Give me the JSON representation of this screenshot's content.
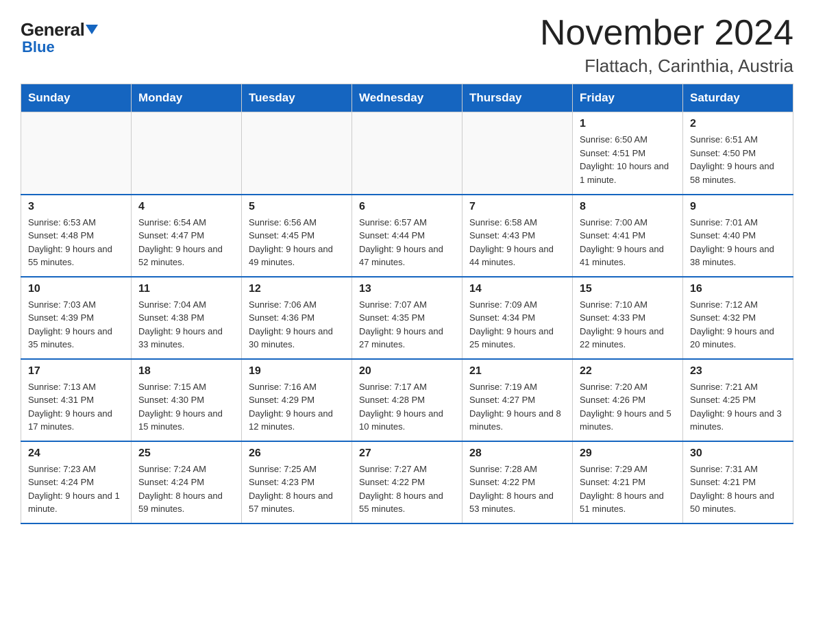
{
  "logo": {
    "general": "General",
    "blue": "Blue",
    "triangle_color": "#1565c0"
  },
  "title": "November 2024",
  "subtitle": "Flattach, Carinthia, Austria",
  "days_of_week": [
    "Sunday",
    "Monday",
    "Tuesday",
    "Wednesday",
    "Thursday",
    "Friday",
    "Saturday"
  ],
  "weeks": [
    [
      {
        "day": "",
        "info": ""
      },
      {
        "day": "",
        "info": ""
      },
      {
        "day": "",
        "info": ""
      },
      {
        "day": "",
        "info": ""
      },
      {
        "day": "",
        "info": ""
      },
      {
        "day": "1",
        "info": "Sunrise: 6:50 AM\nSunset: 4:51 PM\nDaylight: 10 hours and 1 minute."
      },
      {
        "day": "2",
        "info": "Sunrise: 6:51 AM\nSunset: 4:50 PM\nDaylight: 9 hours and 58 minutes."
      }
    ],
    [
      {
        "day": "3",
        "info": "Sunrise: 6:53 AM\nSunset: 4:48 PM\nDaylight: 9 hours and 55 minutes."
      },
      {
        "day": "4",
        "info": "Sunrise: 6:54 AM\nSunset: 4:47 PM\nDaylight: 9 hours and 52 minutes."
      },
      {
        "day": "5",
        "info": "Sunrise: 6:56 AM\nSunset: 4:45 PM\nDaylight: 9 hours and 49 minutes."
      },
      {
        "day": "6",
        "info": "Sunrise: 6:57 AM\nSunset: 4:44 PM\nDaylight: 9 hours and 47 minutes."
      },
      {
        "day": "7",
        "info": "Sunrise: 6:58 AM\nSunset: 4:43 PM\nDaylight: 9 hours and 44 minutes."
      },
      {
        "day": "8",
        "info": "Sunrise: 7:00 AM\nSunset: 4:41 PM\nDaylight: 9 hours and 41 minutes."
      },
      {
        "day": "9",
        "info": "Sunrise: 7:01 AM\nSunset: 4:40 PM\nDaylight: 9 hours and 38 minutes."
      }
    ],
    [
      {
        "day": "10",
        "info": "Sunrise: 7:03 AM\nSunset: 4:39 PM\nDaylight: 9 hours and 35 minutes."
      },
      {
        "day": "11",
        "info": "Sunrise: 7:04 AM\nSunset: 4:38 PM\nDaylight: 9 hours and 33 minutes."
      },
      {
        "day": "12",
        "info": "Sunrise: 7:06 AM\nSunset: 4:36 PM\nDaylight: 9 hours and 30 minutes."
      },
      {
        "day": "13",
        "info": "Sunrise: 7:07 AM\nSunset: 4:35 PM\nDaylight: 9 hours and 27 minutes."
      },
      {
        "day": "14",
        "info": "Sunrise: 7:09 AM\nSunset: 4:34 PM\nDaylight: 9 hours and 25 minutes."
      },
      {
        "day": "15",
        "info": "Sunrise: 7:10 AM\nSunset: 4:33 PM\nDaylight: 9 hours and 22 minutes."
      },
      {
        "day": "16",
        "info": "Sunrise: 7:12 AM\nSunset: 4:32 PM\nDaylight: 9 hours and 20 minutes."
      }
    ],
    [
      {
        "day": "17",
        "info": "Sunrise: 7:13 AM\nSunset: 4:31 PM\nDaylight: 9 hours and 17 minutes."
      },
      {
        "day": "18",
        "info": "Sunrise: 7:15 AM\nSunset: 4:30 PM\nDaylight: 9 hours and 15 minutes."
      },
      {
        "day": "19",
        "info": "Sunrise: 7:16 AM\nSunset: 4:29 PM\nDaylight: 9 hours and 12 minutes."
      },
      {
        "day": "20",
        "info": "Sunrise: 7:17 AM\nSunset: 4:28 PM\nDaylight: 9 hours and 10 minutes."
      },
      {
        "day": "21",
        "info": "Sunrise: 7:19 AM\nSunset: 4:27 PM\nDaylight: 9 hours and 8 minutes."
      },
      {
        "day": "22",
        "info": "Sunrise: 7:20 AM\nSunset: 4:26 PM\nDaylight: 9 hours and 5 minutes."
      },
      {
        "day": "23",
        "info": "Sunrise: 7:21 AM\nSunset: 4:25 PM\nDaylight: 9 hours and 3 minutes."
      }
    ],
    [
      {
        "day": "24",
        "info": "Sunrise: 7:23 AM\nSunset: 4:24 PM\nDaylight: 9 hours and 1 minute."
      },
      {
        "day": "25",
        "info": "Sunrise: 7:24 AM\nSunset: 4:24 PM\nDaylight: 8 hours and 59 minutes."
      },
      {
        "day": "26",
        "info": "Sunrise: 7:25 AM\nSunset: 4:23 PM\nDaylight: 8 hours and 57 minutes."
      },
      {
        "day": "27",
        "info": "Sunrise: 7:27 AM\nSunset: 4:22 PM\nDaylight: 8 hours and 55 minutes."
      },
      {
        "day": "28",
        "info": "Sunrise: 7:28 AM\nSunset: 4:22 PM\nDaylight: 8 hours and 53 minutes."
      },
      {
        "day": "29",
        "info": "Sunrise: 7:29 AM\nSunset: 4:21 PM\nDaylight: 8 hours and 51 minutes."
      },
      {
        "day": "30",
        "info": "Sunrise: 7:31 AM\nSunset: 4:21 PM\nDaylight: 8 hours and 50 minutes."
      }
    ]
  ]
}
